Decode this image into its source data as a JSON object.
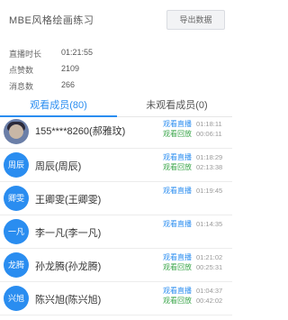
{
  "header": {
    "title": "MBE风格绘画练习",
    "export_label": "导出数据"
  },
  "stats": [
    {
      "label": "直播时长",
      "value": "01:21:55"
    },
    {
      "label": "点赞数",
      "value": "2109"
    },
    {
      "label": "消息数",
      "value": "266"
    }
  ],
  "tabs": {
    "watched": "观看成员(80)",
    "unwatched": "未观看成员(0)"
  },
  "members": [
    {
      "avatar": "",
      "name": "155****8260(郝雅玟)",
      "logs": [
        {
          "type": "观看直播",
          "kind": "live",
          "time": "01:18:11"
        },
        {
          "type": "观看回放",
          "kind": "replay",
          "time": "00:06:11"
        }
      ]
    },
    {
      "avatar": "周辰",
      "name": "周辰(周辰)",
      "logs": [
        {
          "type": "观看直播",
          "kind": "live",
          "time": "01:18:29"
        },
        {
          "type": "观看回放",
          "kind": "replay",
          "time": "02:13:38"
        }
      ]
    },
    {
      "avatar": "卿雯",
      "name": "王卿雯(王卿雯)",
      "logs": [
        {
          "type": "观看直播",
          "kind": "live",
          "time": "01:19:45"
        }
      ]
    },
    {
      "avatar": "一凡",
      "name": "李一凡(李一凡)",
      "logs": [
        {
          "type": "观看直播",
          "kind": "live",
          "time": "01:14:35"
        }
      ]
    },
    {
      "avatar": "龙腾",
      "name": "孙龙腾(孙龙腾)",
      "logs": [
        {
          "type": "观看直播",
          "kind": "live",
          "time": "01:21:02"
        },
        {
          "type": "观看回放",
          "kind": "replay",
          "time": "00:25:31"
        }
      ]
    },
    {
      "avatar": "兴旭",
      "name": "陈兴旭(陈兴旭)",
      "logs": [
        {
          "type": "观看直播",
          "kind": "live",
          "time": "01:04:37"
        },
        {
          "type": "观看回放",
          "kind": "replay",
          "time": "00:42:02"
        }
      ]
    }
  ]
}
